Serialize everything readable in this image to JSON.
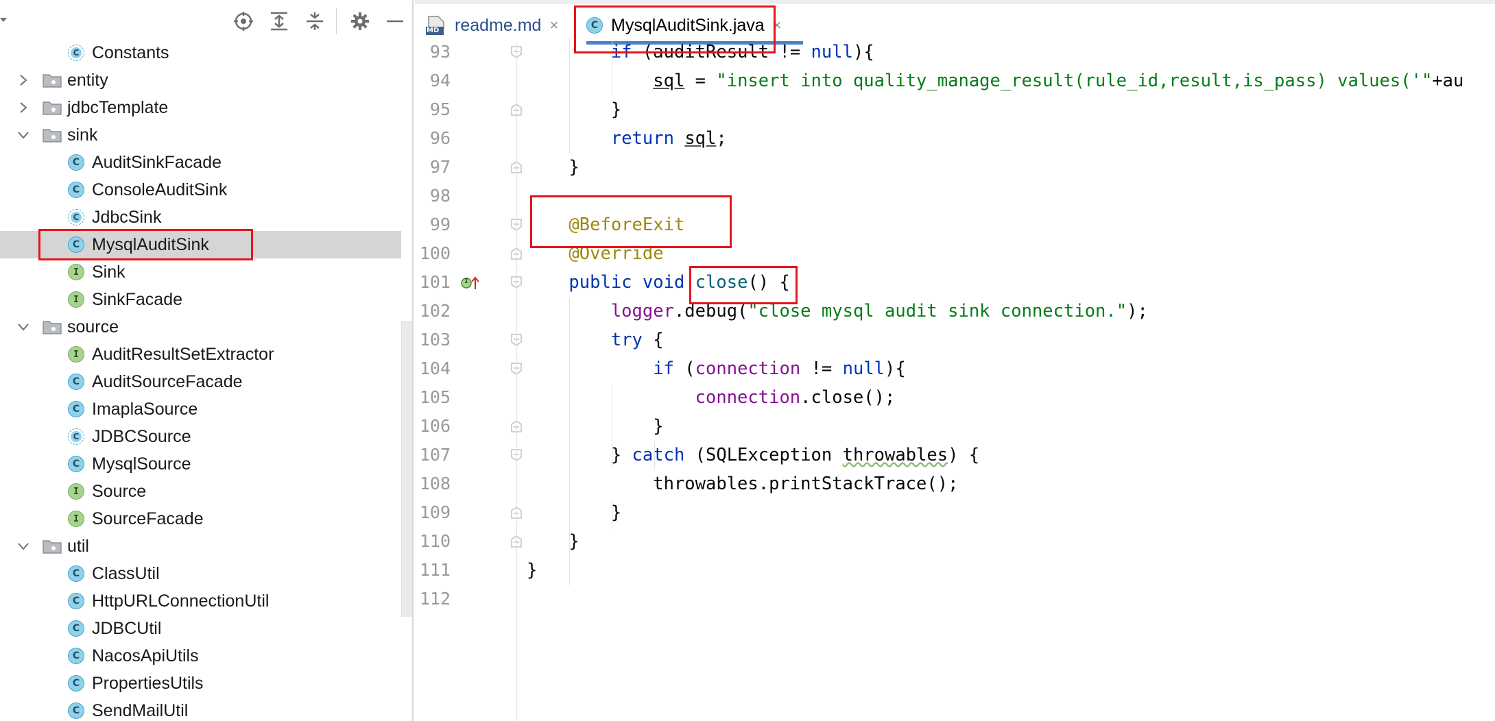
{
  "project_panel": {
    "toolbar_icons": [
      "locate-icon",
      "expand-all-icon",
      "collapse-all-icon",
      "gear-icon",
      "minimize-icon"
    ],
    "tree": [
      {
        "label": "Constants",
        "kind": "abstract",
        "depth": 2
      },
      {
        "label": "entity",
        "kind": "folder",
        "depth": 1,
        "expanded": false
      },
      {
        "label": "jdbcTemplate",
        "kind": "folder",
        "depth": 1,
        "expanded": false
      },
      {
        "label": "sink",
        "kind": "folder",
        "depth": 1,
        "expanded": true
      },
      {
        "label": "AuditSinkFacade",
        "kind": "class",
        "depth": 2
      },
      {
        "label": "ConsoleAuditSink",
        "kind": "class",
        "depth": 2
      },
      {
        "label": "JdbcSink",
        "kind": "abstract",
        "depth": 2
      },
      {
        "label": "MysqlAuditSink",
        "kind": "class",
        "depth": 2,
        "selected": true
      },
      {
        "label": "Sink",
        "kind": "interface",
        "depth": 2
      },
      {
        "label": "SinkFacade",
        "kind": "interface",
        "depth": 2
      },
      {
        "label": "source",
        "kind": "folder",
        "depth": 1,
        "expanded": true
      },
      {
        "label": "AuditResultSetExtractor",
        "kind": "interface",
        "depth": 2
      },
      {
        "label": "AuditSourceFacade",
        "kind": "class",
        "depth": 2
      },
      {
        "label": "ImaplaSource",
        "kind": "class",
        "depth": 2
      },
      {
        "label": "JDBCSource",
        "kind": "abstract",
        "depth": 2
      },
      {
        "label": "MysqlSource",
        "kind": "class",
        "depth": 2
      },
      {
        "label": "Source",
        "kind": "interface",
        "depth": 2
      },
      {
        "label": "SourceFacade",
        "kind": "interface",
        "depth": 2
      },
      {
        "label": "util",
        "kind": "folder",
        "depth": 1,
        "expanded": true
      },
      {
        "label": "ClassUtil",
        "kind": "class",
        "depth": 2
      },
      {
        "label": "HttpURLConnectionUtil",
        "kind": "class",
        "depth": 2
      },
      {
        "label": "JDBCUtil",
        "kind": "class",
        "depth": 2
      },
      {
        "label": "NacosApiUtils",
        "kind": "class",
        "depth": 2
      },
      {
        "label": "PropertiesUtils",
        "kind": "class",
        "depth": 2
      },
      {
        "label": "SendMailUtil",
        "kind": "class",
        "depth": 2
      }
    ],
    "icon_letters": {
      "class": "C",
      "interface": "I",
      "md": "MD"
    }
  },
  "editor": {
    "tabs": [
      {
        "label": "readme.md",
        "icon": "markdown-icon",
        "active": false,
        "close": "×"
      },
      {
        "label": "MysqlAuditSink.java",
        "icon": "java-class-icon",
        "active": true,
        "close": "×"
      }
    ],
    "lines": [
      {
        "no": "93",
        "tokens": [
          [
            "        ",
            ""
          ],
          [
            "if",
            "kw"
          ],
          [
            " (auditResult != ",
            ""
          ],
          [
            "null",
            "kw"
          ],
          [
            "){",
            ""
          ]
        ]
      },
      {
        "no": "94",
        "tokens": [
          [
            "            ",
            ""
          ],
          [
            "sql",
            "ul"
          ],
          [
            " = ",
            ""
          ],
          [
            "\"insert into quality_manage_result(rule_id,result,is_pass) values('\"",
            "str"
          ],
          [
            "+au",
            ""
          ]
        ]
      },
      {
        "no": "95",
        "tokens": [
          [
            "        }",
            ""
          ]
        ]
      },
      {
        "no": "96",
        "tokens": [
          [
            "        ",
            ""
          ],
          [
            "return",
            "kw"
          ],
          [
            " ",
            ""
          ],
          [
            "sql",
            "ul"
          ],
          [
            ";",
            ""
          ]
        ]
      },
      {
        "no": "97",
        "tokens": [
          [
            "    }",
            ""
          ]
        ]
      },
      {
        "no": "98",
        "tokens": []
      },
      {
        "no": "99",
        "tokens": [
          [
            "    ",
            ""
          ],
          [
            "@BeforeExit",
            "ann"
          ]
        ]
      },
      {
        "no": "100",
        "tokens": [
          [
            "    ",
            ""
          ],
          [
            "@Override",
            "ann"
          ]
        ]
      },
      {
        "no": "101",
        "tokens": [
          [
            "    ",
            ""
          ],
          [
            "public",
            "kw"
          ],
          [
            " ",
            ""
          ],
          [
            "void",
            "kw"
          ],
          [
            " ",
            ""
          ],
          [
            "close",
            "mth"
          ],
          [
            "() {",
            ""
          ]
        ]
      },
      {
        "no": "102",
        "tokens": [
          [
            "        ",
            ""
          ],
          [
            "logger",
            "fld"
          ],
          [
            ".debug(",
            ""
          ],
          [
            "\"close mysql audit sink connection.\"",
            "str"
          ],
          [
            ");",
            ""
          ]
        ]
      },
      {
        "no": "103",
        "tokens": [
          [
            "        ",
            ""
          ],
          [
            "try",
            "kw"
          ],
          [
            " {",
            ""
          ]
        ]
      },
      {
        "no": "104",
        "tokens": [
          [
            "            ",
            ""
          ],
          [
            "if",
            "kw"
          ],
          [
            " (",
            ""
          ],
          [
            "connection",
            "fld"
          ],
          [
            " != ",
            ""
          ],
          [
            "null",
            "kw"
          ],
          [
            "){",
            ""
          ]
        ]
      },
      {
        "no": "105",
        "tokens": [
          [
            "                ",
            ""
          ],
          [
            "connection",
            "fld"
          ],
          [
            ".close();",
            ""
          ]
        ]
      },
      {
        "no": "106",
        "tokens": [
          [
            "            }",
            ""
          ]
        ]
      },
      {
        "no": "107",
        "tokens": [
          [
            "        } ",
            ""
          ],
          [
            "catch",
            "kw"
          ],
          [
            " (SQLException ",
            ""
          ],
          [
            "throwables",
            "wavy"
          ],
          [
            ") {",
            ""
          ]
        ]
      },
      {
        "no": "108",
        "tokens": [
          [
            "            throwables.printStackTrace();",
            ""
          ]
        ]
      },
      {
        "no": "109",
        "tokens": [
          [
            "        }",
            ""
          ]
        ]
      },
      {
        "no": "110",
        "tokens": [
          [
            "    }",
            ""
          ]
        ]
      },
      {
        "no": "111",
        "tokens": [
          [
            "}",
            ""
          ]
        ]
      },
      {
        "no": "112",
        "tokens": []
      }
    ],
    "implements_marker_letter": "I"
  },
  "colors": {
    "highlight_red": "#e6141b",
    "keyword": "#0033b3",
    "string": "#067d17",
    "annotation": "#9e880d",
    "field": "#871094",
    "method": "#00627a",
    "active_tab_underline": "#4a82c8",
    "selection": "#d5d5d5"
  }
}
